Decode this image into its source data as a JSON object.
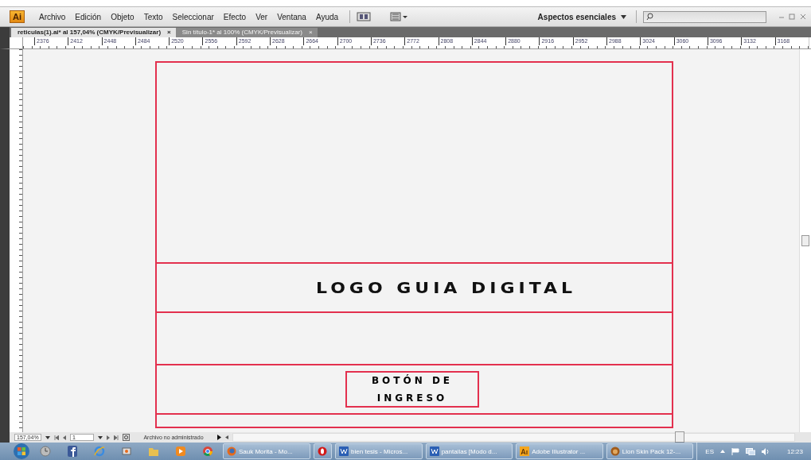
{
  "app": {
    "logo": "Ai",
    "menu": [
      "Archivo",
      "Edición",
      "Objeto",
      "Texto",
      "Seleccionar",
      "Efecto",
      "Ver",
      "Ventana",
      "Ayuda"
    ],
    "workspace": "Aspectos esenciales"
  },
  "tabs": [
    {
      "label": "reticulas(1).ai* al 157,04% (CMYK/Previsualizar)",
      "close": "×",
      "selected": true
    },
    {
      "label": "Sin título-1* al 100% (CMYK/Previsualizar)",
      "close": "×",
      "selected": false
    }
  ],
  "ruler": {
    "labels": [
      "2376",
      "2412",
      "2448",
      "2484",
      "2520",
      "2556",
      "2592",
      "2628",
      "2664",
      "2700",
      "2736",
      "2772",
      "2808",
      "2844",
      "2880",
      "2916",
      "2952",
      "2988",
      "3024",
      "3060",
      "3096",
      "3132",
      "3168"
    ]
  },
  "artboard": {
    "logo_text": "LOGO GUIA DIGITAL",
    "button_text": "BOTÓN DE INGRESO"
  },
  "status_bar": {
    "zoom": "157,04%",
    "page": "1",
    "file_status": "Archivo no administrado"
  },
  "taskbar": {
    "tasks": [
      {
        "kind": "labeled",
        "label": "Sauk Morita - Mo..."
      },
      {
        "kind": "compact"
      },
      {
        "kind": "labeled",
        "label": "bien tesis - Micros..."
      },
      {
        "kind": "labeled",
        "label": "pantallas [Modo d..."
      },
      {
        "kind": "labeled",
        "label": "Adobe Illustrator ..."
      },
      {
        "kind": "labeled",
        "label": "Lion Skin Pack 12-..."
      }
    ],
    "language": "ES",
    "time": "12:23"
  }
}
